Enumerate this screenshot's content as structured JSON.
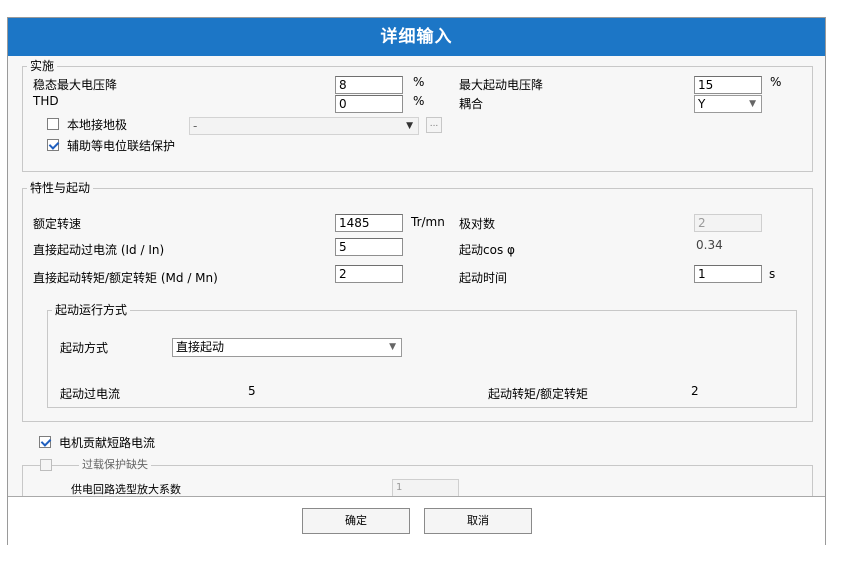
{
  "title": "详细输入",
  "impl": {
    "legend": "实施",
    "steady_drop_label": "稳态最大电压降",
    "steady_drop_value": "8",
    "steady_drop_unit": "%",
    "thd_label": "THD",
    "thd_value": "0",
    "thd_unit": "%",
    "max_start_drop_label": "最大起动电压降",
    "max_start_drop_value": "15",
    "max_start_drop_unit": "%",
    "coupling_label": "耦合",
    "coupling_value": "Y",
    "local_ground_label": "本地接地极",
    "local_ground_checked": false,
    "local_ground_combo_value": "-",
    "more_button": "...",
    "aux_bonding_label": "辅助等电位联结保护",
    "aux_bonding_checked": true
  },
  "char": {
    "legend": "特性与起动",
    "rated_speed_label": "额定转速",
    "rated_speed_value": "1485",
    "rated_speed_unit": "Tr/mn",
    "pole_pairs_label": "极对数",
    "pole_pairs_value": "2",
    "dol_current_label": "直接起动过电流 (Id / In)",
    "dol_current_value": "5",
    "start_cos_label": "起动cos φ",
    "start_cos_value": "0.34",
    "dol_torque_label": "直接起动转矩/额定转矩 (Md / Mn)",
    "dol_torque_value": "2",
    "start_time_label": "起动时间",
    "start_time_value": "1",
    "start_time_unit": "s"
  },
  "run_mode": {
    "legend": "起动运行方式",
    "start_mode_label": "起动方式",
    "start_mode_value": "直接起动",
    "start_current_label": "起动过电流",
    "start_current_value": "5",
    "start_torque_label": "起动转矩/额定转矩",
    "start_torque_value": "2"
  },
  "motor_contrib_label": "电机贡献短路电流",
  "motor_contrib_checked": true,
  "overload": {
    "legend": "过载保护缺失",
    "checked": false,
    "factor_label": "供电回路选型放大系数",
    "factor_value": "1"
  },
  "buttons": {
    "ok": "确定",
    "cancel": "取消"
  }
}
